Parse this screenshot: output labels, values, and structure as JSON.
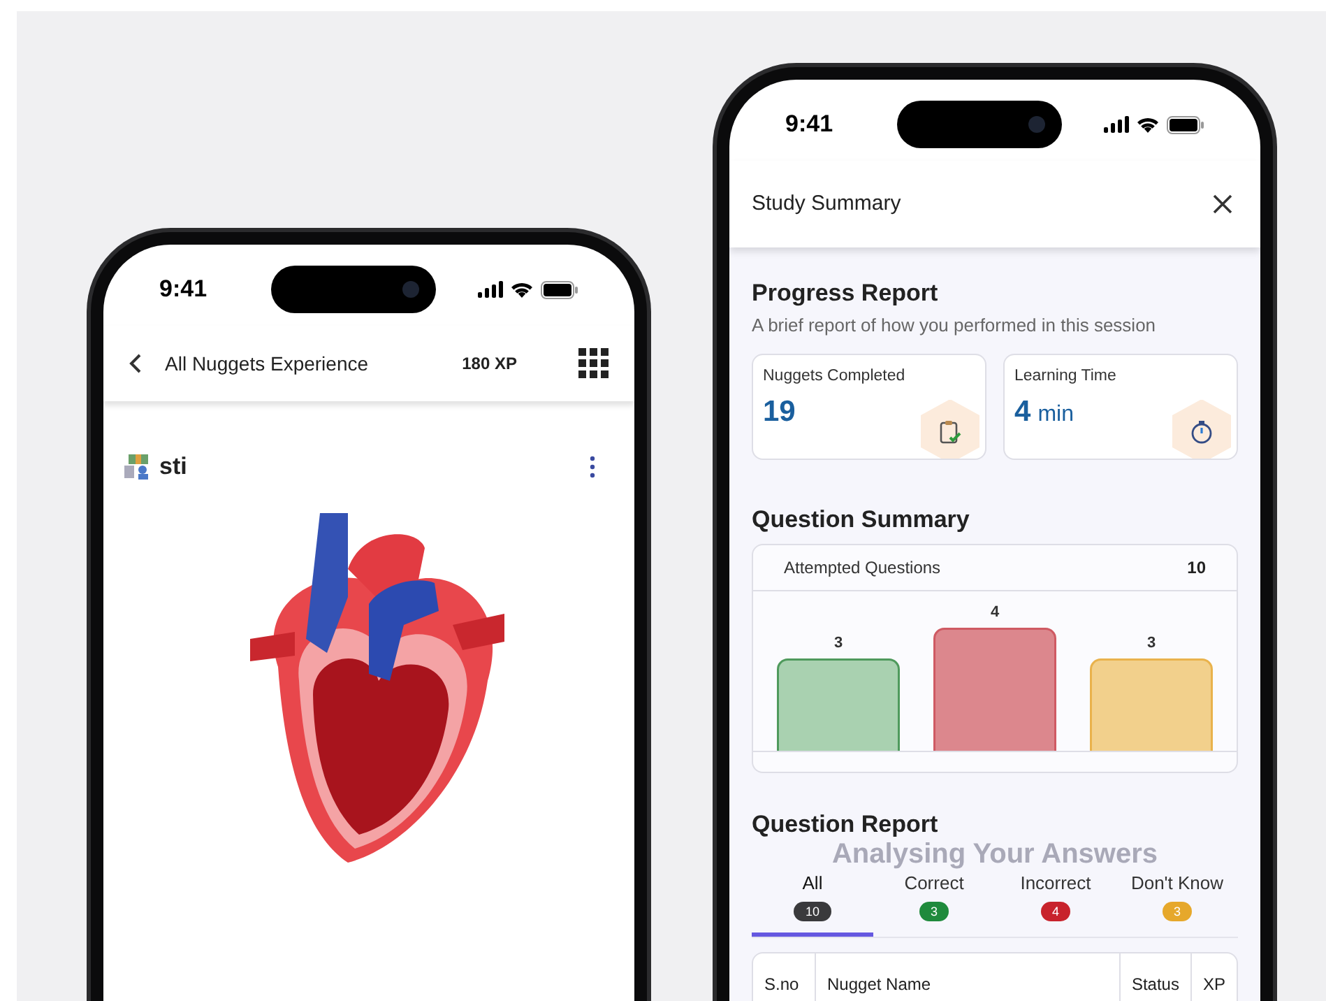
{
  "left_phone": {
    "status_bar": {
      "time": "9:41"
    },
    "header": {
      "title": "All Nuggets Experience",
      "xp": "180 XP"
    },
    "nugget": {
      "title": "sti"
    }
  },
  "right_phone": {
    "status_bar": {
      "time": "9:41"
    },
    "header": {
      "title": "Study Summary"
    },
    "progress_report": {
      "title": "Progress Report",
      "subtitle": "A brief report of how you performed in this session",
      "stats": [
        {
          "kind": "clipboard",
          "label": "Nuggets Completed",
          "value": "19"
        },
        {
          "kind": "stopwatch",
          "label": "Learning Time",
          "value": "4",
          "unit": "min"
        }
      ]
    },
    "question_summary": {
      "title": "Question Summary",
      "attempted_label": "Attempted Questions",
      "attempted_value": "10",
      "chart_data": {
        "type": "bar",
        "values": [
          3,
          4,
          3
        ],
        "colors": [
          "#a9d1b0",
          "#dc878d",
          "#f2d08c"
        ],
        "data_labels": true
      }
    },
    "question_report": {
      "title": "Question Report",
      "overlay_text": "Analysing Your Answers",
      "tabs": [
        {
          "label": "All",
          "count": "10",
          "color": "#3a3a3c",
          "selected": true
        },
        {
          "label": "Correct",
          "count": "3",
          "color": "#1f8a3c",
          "selected": false
        },
        {
          "label": "Incorrect",
          "count": "4",
          "color": "#c8232c",
          "selected": false
        },
        {
          "label": "Don't Know",
          "count": "3",
          "color": "#e6a82b",
          "selected": false
        }
      ],
      "table": {
        "columns": [
          "S.no",
          "Nugget Name",
          "Status",
          "XP"
        ]
      }
    }
  }
}
